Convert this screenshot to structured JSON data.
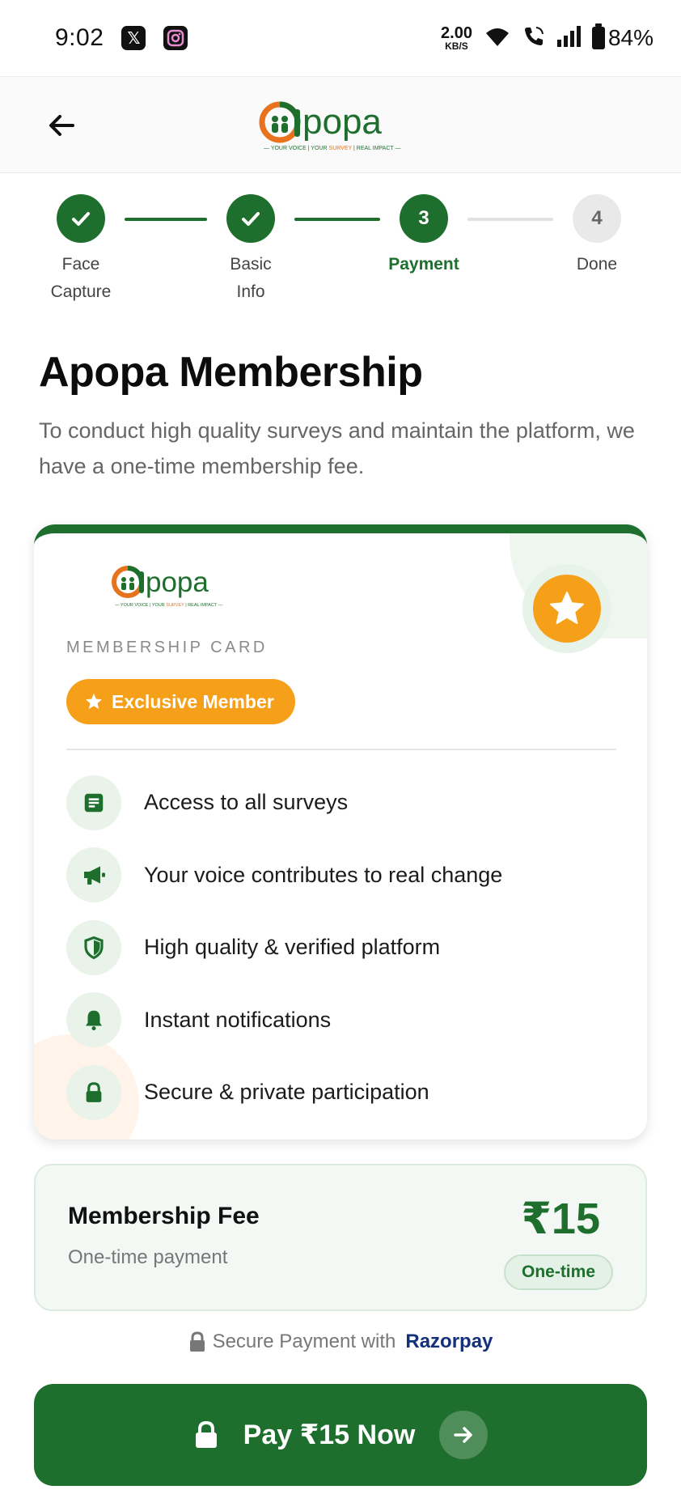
{
  "status_bar": {
    "time": "9:02",
    "apps": [
      "x-icon",
      "instagram-icon"
    ],
    "net_speed_value": "2.00",
    "net_speed_unit": "KB/S",
    "battery": "84%"
  },
  "header": {
    "logo_text": "apopa",
    "logo_tagline": "YOUR VOICE | YOUR SURVEY | REAL IMPACT"
  },
  "stepper": {
    "steps": [
      {
        "num": "1",
        "label_line1": "Face",
        "label_line2": "Capture",
        "state": "done"
      },
      {
        "num": "2",
        "label_line1": "Basic",
        "label_line2": "Info",
        "state": "done"
      },
      {
        "num": "3",
        "label_line1": "Payment",
        "label_line2": "",
        "state": "active"
      },
      {
        "num": "4",
        "label_line1": "Done",
        "label_line2": "",
        "state": "todo"
      }
    ]
  },
  "main": {
    "title": "Apopa Membership",
    "subtitle": "To conduct high quality surveys and maintain the platform, we have a one-time membership fee."
  },
  "card": {
    "label": "MEMBERSHIP CARD",
    "badge": "Exclusive Member",
    "features": [
      {
        "icon": "document-icon",
        "text": "Access to all surveys"
      },
      {
        "icon": "megaphone-icon",
        "text": "Your voice contributes to real change"
      },
      {
        "icon": "shield-icon",
        "text": "High quality & verified platform"
      },
      {
        "icon": "bell-icon",
        "text": "Instant notifications"
      },
      {
        "icon": "lock-icon",
        "text": "Secure & private participation"
      }
    ]
  },
  "fee": {
    "title": "Membership Fee",
    "subtitle": "One-time payment",
    "amount": "₹15",
    "tag": "One-time"
  },
  "secure": {
    "text": "Secure Payment with",
    "brand": "Razorpay"
  },
  "pay_button": {
    "label": "Pay ₹15 Now"
  },
  "colors": {
    "primary": "#1e6f2e",
    "accent": "#f6a01a",
    "razorpay": "#14307a"
  }
}
